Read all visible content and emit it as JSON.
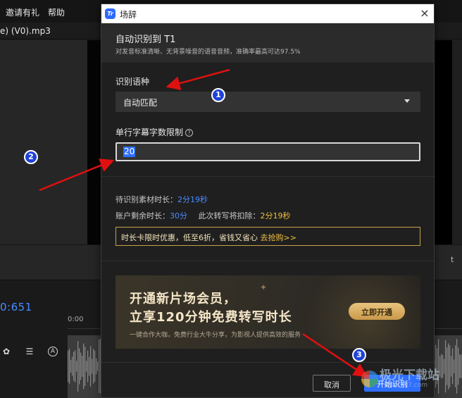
{
  "app": {
    "menu": [
      "邀请有礼",
      "帮助"
    ],
    "file_name": "e) (V0).mp3",
    "timecode": "0:651",
    "ruler_start": "0:00",
    "side_glyph": "t",
    "tool_icons": [
      "palette-icon",
      "list-icon",
      "a-circle-icon"
    ]
  },
  "dialog": {
    "title": "场辞",
    "close_glyph": "×",
    "logo_text": "Tr",
    "heading": "自动识别到 T1",
    "subheading": "对发音标准清晰、无背景噪音的语音音频，准确率最高可达97.5%",
    "language": {
      "label": "识别语种",
      "value": "自动匹配"
    },
    "char_limit": {
      "label": "单行字幕字数限制",
      "help_glyph": "?",
      "value": "20"
    },
    "info": {
      "pending_label": "待识别素材时长：",
      "pending_value": "2分19秒",
      "remaining_label": "账户剩余时长：",
      "remaining_value": "30分",
      "deduct_label": "此次转写将扣除：",
      "deduct_value": "2分19秒"
    },
    "promo": {
      "text": "时长卡限时优惠，低至6折，省钱又省心",
      "link": "去抢购>>"
    },
    "banner": {
      "line1": "开通新片场会员，",
      "line2": "立享120分钟免费转写时长",
      "desc": "一键合作大咖，免费行业大牛分享，为影视人提供高效的服务",
      "button": "立即开通"
    },
    "buttons": {
      "cancel": "取消",
      "start": "开始识别"
    }
  },
  "annotations": {
    "badges": [
      "1",
      "2",
      "3"
    ],
    "arrow_color": "#e01010",
    "badge_color": "#1f43d8"
  },
  "watermark": {
    "text": "极光下载站",
    "sub": "www.xz7.com"
  },
  "colors": {
    "accent": "#2f6fff",
    "timecode": "#4a8cff",
    "gold": "#f0c040"
  }
}
